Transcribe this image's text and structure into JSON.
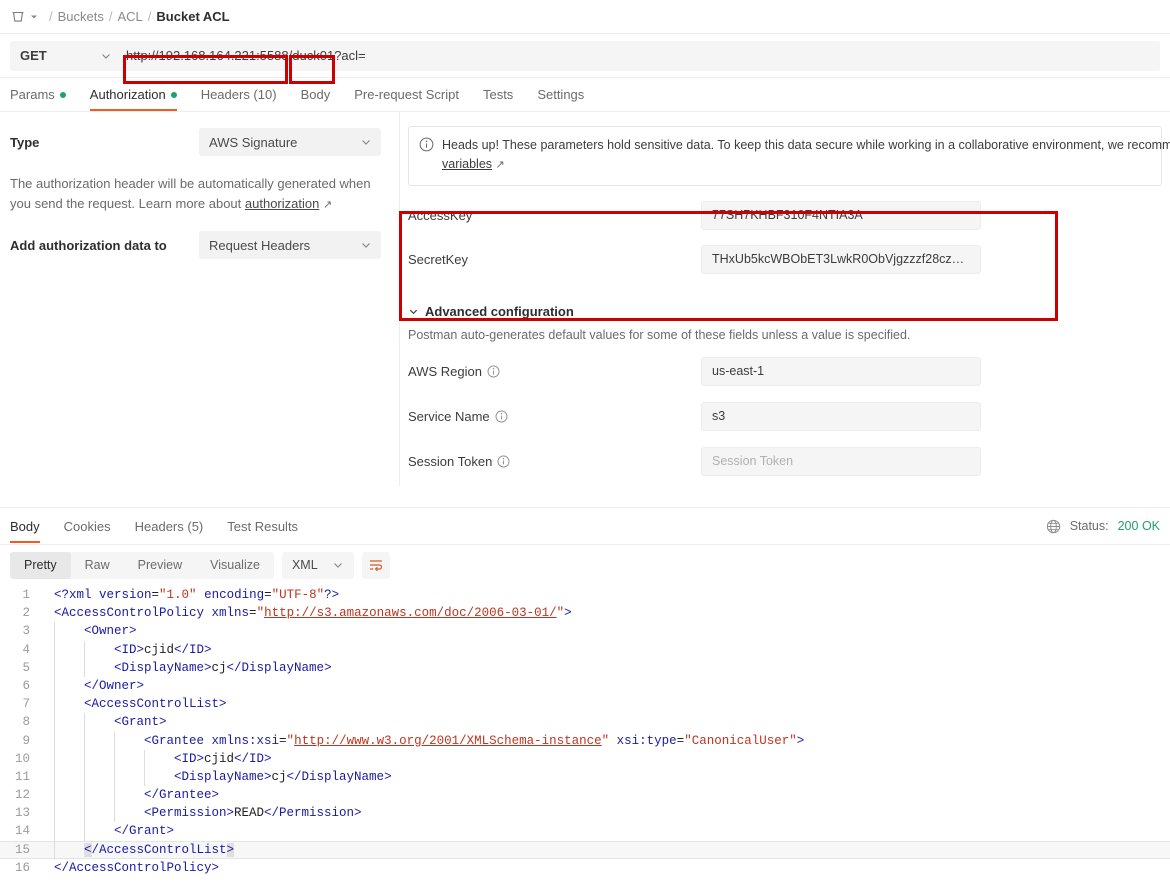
{
  "breadcrumb": {
    "bucket_icon": "bucket-icon",
    "chevron_icon": "chevron-down-icon",
    "items": [
      {
        "label": "Buckets",
        "current": false
      },
      {
        "label": "ACL",
        "current": false
      },
      {
        "label": "Bucket ACL",
        "current": true
      }
    ],
    "separator": "/"
  },
  "request": {
    "method": "GET",
    "url_host": "http://192.168.164.221:5588",
    "url_slash": "/",
    "url_bucket": "duck01",
    "url_query": "?acl=",
    "tabs": [
      {
        "label": "Params",
        "dot": true,
        "active": false
      },
      {
        "label": "Authorization",
        "dot": true,
        "active": true
      },
      {
        "label": "Headers (10)",
        "dot": false,
        "active": false
      },
      {
        "label": "Body",
        "dot": false,
        "active": false
      },
      {
        "label": "Pre-request Script",
        "dot": false,
        "active": false
      },
      {
        "label": "Tests",
        "dot": false,
        "active": false
      },
      {
        "label": "Settings",
        "dot": false,
        "active": false
      }
    ]
  },
  "auth": {
    "type_label": "Type",
    "type_value": "AWS Signature",
    "helper_text_a": "The authorization header will be automatically generated when you send the request. Learn more about ",
    "helper_link": "authorization",
    "helper_arrow": "↗",
    "add_data_label": "Add authorization data to",
    "add_data_value": "Request Headers"
  },
  "notice": {
    "icon": "info-icon",
    "text": "Heads up! These parameters hold sensitive data. To keep this data secure while working in a collaborative environment, we recomm",
    "link": "variables",
    "arrow": "↗"
  },
  "credentials": [
    {
      "label": "AccessKey",
      "value": "77SH7KHBF310F4NTIA3A",
      "placeholder": false
    },
    {
      "label": "SecretKey",
      "value": "THxUb5kcWBObET3LwkR0ObVjgzzzf28cz…",
      "placeholder": false
    }
  ],
  "advanced": {
    "title": "Advanced configuration",
    "chevron_icon": "chevron-down-icon",
    "subtitle": "Postman auto-generates default values for some of these fields unless a value is specified.",
    "rows": [
      {
        "label": "AWS Region",
        "info_icon": "info-icon",
        "value": "us-east-1",
        "placeholder": false
      },
      {
        "label": "Service Name",
        "info_icon": "info-icon",
        "value": "s3",
        "placeholder": false
      },
      {
        "label": "Session Token",
        "info_icon": "info-icon",
        "value": "Session Token",
        "placeholder": true
      }
    ]
  },
  "response": {
    "tabs": [
      {
        "label": "Body",
        "active": true
      },
      {
        "label": "Cookies",
        "active": false
      },
      {
        "label": "Headers (5)",
        "active": false
      },
      {
        "label": "Test Results",
        "active": false
      }
    ],
    "globe_icon": "globe-icon",
    "status_label": "Status:",
    "status_value": "200 OK",
    "status_color": "#22a06b",
    "view_modes": [
      {
        "label": "Pretty",
        "active": true
      },
      {
        "label": "Raw",
        "active": false
      },
      {
        "label": "Preview",
        "active": false
      },
      {
        "label": "Visualize",
        "active": false
      }
    ],
    "format": "XML",
    "format_chevron": "chevron-down-icon",
    "wrap_icon": "word-wrap-icon"
  },
  "code": {
    "lines": [
      {
        "n": 1,
        "guides": 0,
        "indent": 0,
        "parts": [
          {
            "t": "<?xml ",
            "c": "tk"
          },
          {
            "t": "version",
            "c": "at"
          },
          {
            "t": "=",
            "c": "tx"
          },
          {
            "t": "\"1.0\"",
            "c": "va"
          },
          {
            "t": " ",
            "c": "tx"
          },
          {
            "t": "encoding",
            "c": "at"
          },
          {
            "t": "=",
            "c": "tx"
          },
          {
            "t": "\"UTF-8\"",
            "c": "va"
          },
          {
            "t": "?>",
            "c": "tk"
          }
        ]
      },
      {
        "n": 2,
        "guides": 0,
        "indent": 0,
        "parts": [
          {
            "t": "<AccessControlPolicy ",
            "c": "tk"
          },
          {
            "t": "xmlns",
            "c": "at"
          },
          {
            "t": "=",
            "c": "tx"
          },
          {
            "t": "\"",
            "c": "va"
          },
          {
            "t": "http://s3.amazonaws.com/doc/2006-03-01/",
            "c": "ur"
          },
          {
            "t": "\"",
            "c": "va"
          },
          {
            "t": ">",
            "c": "tk"
          }
        ]
      },
      {
        "n": 3,
        "guides": 1,
        "indent": 1,
        "parts": [
          {
            "t": "<Owner>",
            "c": "tk"
          }
        ]
      },
      {
        "n": 4,
        "guides": 2,
        "indent": 2,
        "parts": [
          {
            "t": "<ID>",
            "c": "tk"
          },
          {
            "t": "cjid",
            "c": "tx"
          },
          {
            "t": "</ID>",
            "c": "tk"
          }
        ]
      },
      {
        "n": 5,
        "guides": 2,
        "indent": 2,
        "parts": [
          {
            "t": "<DisplayName>",
            "c": "tk"
          },
          {
            "t": "cj",
            "c": "tx"
          },
          {
            "t": "</DisplayName>",
            "c": "tk"
          }
        ]
      },
      {
        "n": 6,
        "guides": 1,
        "indent": 1,
        "parts": [
          {
            "t": "</Owner>",
            "c": "tk"
          }
        ]
      },
      {
        "n": 7,
        "guides": 1,
        "indent": 1,
        "parts": [
          {
            "t": "<AccessControlList>",
            "c": "tk"
          }
        ]
      },
      {
        "n": 8,
        "guides": 2,
        "indent": 2,
        "parts": [
          {
            "t": "<Grant>",
            "c": "tk"
          }
        ]
      },
      {
        "n": 9,
        "guides": 3,
        "indent": 3,
        "parts": [
          {
            "t": "<Grantee ",
            "c": "tk"
          },
          {
            "t": "xmlns:xsi",
            "c": "at"
          },
          {
            "t": "=",
            "c": "tx"
          },
          {
            "t": "\"",
            "c": "va"
          },
          {
            "t": "http://www.w3.org/2001/XMLSchema-instance",
            "c": "ur"
          },
          {
            "t": "\"",
            "c": "va"
          },
          {
            "t": " ",
            "c": "tx"
          },
          {
            "t": "xsi:type",
            "c": "at"
          },
          {
            "t": "=",
            "c": "tx"
          },
          {
            "t": "\"CanonicalUser\"",
            "c": "va"
          },
          {
            "t": ">",
            "c": "tk"
          }
        ]
      },
      {
        "n": 10,
        "guides": 4,
        "indent": 4,
        "parts": [
          {
            "t": "<ID>",
            "c": "tk"
          },
          {
            "t": "cjid",
            "c": "tx"
          },
          {
            "t": "</ID>",
            "c": "tk"
          }
        ]
      },
      {
        "n": 11,
        "guides": 4,
        "indent": 4,
        "parts": [
          {
            "t": "<DisplayName>",
            "c": "tk"
          },
          {
            "t": "cj",
            "c": "tx"
          },
          {
            "t": "</DisplayName>",
            "c": "tk"
          }
        ]
      },
      {
        "n": 12,
        "guides": 3,
        "indent": 3,
        "parts": [
          {
            "t": "</Grantee>",
            "c": "tk"
          }
        ]
      },
      {
        "n": 13,
        "guides": 3,
        "indent": 3,
        "parts": [
          {
            "t": "<Permission>",
            "c": "tk"
          },
          {
            "t": "READ",
            "c": "tx"
          },
          {
            "t": "</Permission>",
            "c": "tk"
          }
        ]
      },
      {
        "n": 14,
        "guides": 2,
        "indent": 2,
        "parts": [
          {
            "t": "</Grant>",
            "c": "tk"
          }
        ]
      },
      {
        "n": 15,
        "guides": 1,
        "indent": 1,
        "highlight": true,
        "parts": [
          {
            "t": "<",
            "c": "tk bk"
          },
          {
            "t": "/AccessControlList",
            "c": "tk"
          },
          {
            "t": ">",
            "c": "tk bk"
          }
        ]
      },
      {
        "n": 16,
        "guides": 0,
        "indent": 0,
        "parts": [
          {
            "t": "</AccessControlPolicy>",
            "c": "tk"
          }
        ]
      }
    ]
  }
}
